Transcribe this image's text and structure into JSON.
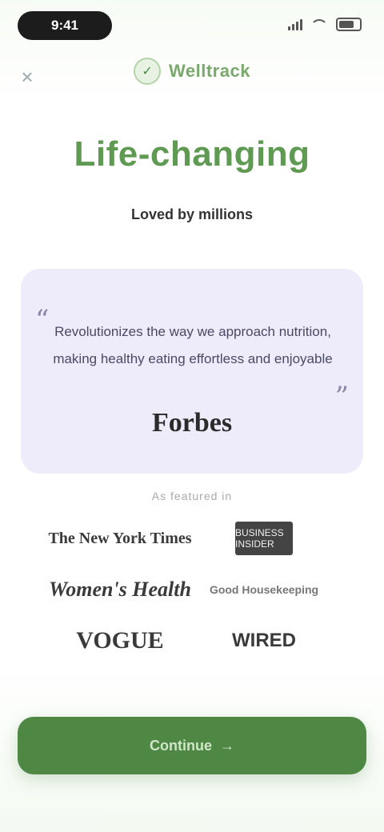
{
  "status_bar": {
    "time": "9:41"
  },
  "brand": {
    "logo_glyph": "✓",
    "name": "Welltrack"
  },
  "headline": "Life-changing",
  "subhead": "Loved by millions",
  "quote": {
    "open_mark": "“",
    "close_mark": "”",
    "text": "Revolutionizes the way we approach nutrition, making healthy eating effortless and enjoyable",
    "source": "Forbes"
  },
  "featured_label": "As featured in",
  "press_logos": [
    "The New York Times",
    "BUSINESS INSIDER",
    "Women's Health",
    "Good Housekeeping",
    "VOGUE",
    "WIRED"
  ],
  "cta": {
    "label": "Continue",
    "arrow": "→"
  },
  "colors": {
    "accent": "#4f8745",
    "headline": "#5f9a52",
    "quote_bg": "#eeebfa"
  }
}
